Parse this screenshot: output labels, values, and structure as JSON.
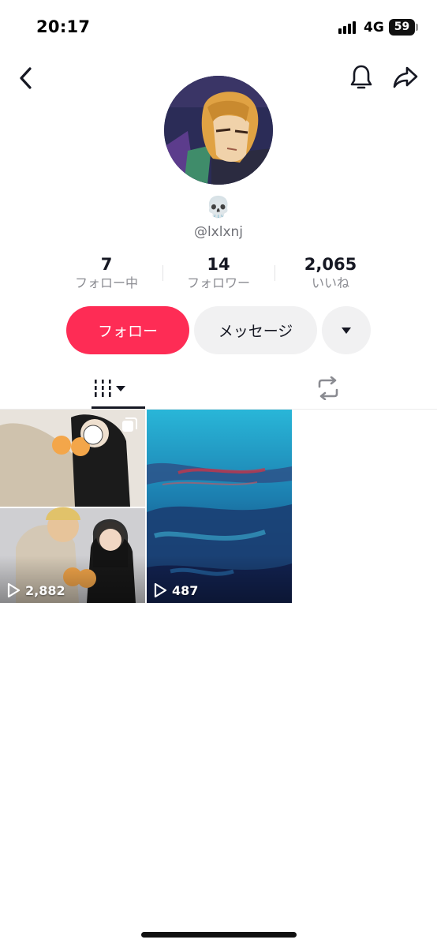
{
  "status_bar": {
    "time": "20:17",
    "network": "4G",
    "battery": "59"
  },
  "header": {
    "back_icon": "chevron-left-icon",
    "bell_icon": "bell-icon",
    "share_icon": "share-arrow-icon"
  },
  "profile": {
    "display_name": "💀",
    "username": "@lxlxnj"
  },
  "stats": [
    {
      "value": "7",
      "label": "フォロー中"
    },
    {
      "value": "14",
      "label": "フォロワー"
    },
    {
      "value": "2,065",
      "label": "いいね"
    }
  ],
  "actions": {
    "follow_label": "フォロー",
    "message_label": "メッセージ",
    "more_icon": "caret-down-icon"
  },
  "tabs": {
    "videos_icon": "grid-bars-icon",
    "reposts_icon": "repost-icon"
  },
  "videos": [
    {
      "plays": "2,882",
      "multi": true
    },
    {
      "plays": "487",
      "multi": false
    }
  ],
  "colors": {
    "accent": "#fe2c55",
    "secondary_button": "#f1f1f2",
    "muted_text": "#8a8b91"
  }
}
